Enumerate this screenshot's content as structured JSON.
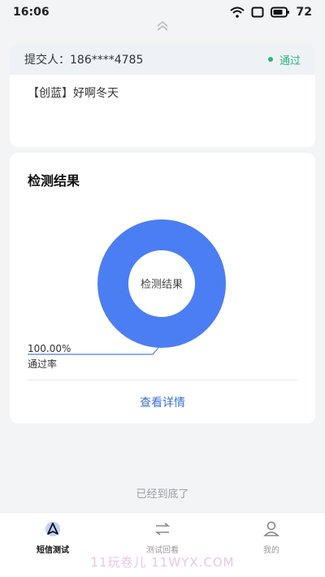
{
  "status_bar": {
    "time": "16:06",
    "battery": "72",
    "icons": [
      "wifi-icon",
      "window-icon",
      "battery-icon"
    ]
  },
  "submission": {
    "submitter_label": "提交人：",
    "submitter_value": "186****4785",
    "status": "通过",
    "status_color": "#2bb673",
    "message": "【创蓝】好啊冬天"
  },
  "result": {
    "title": "检测结果",
    "donut_center_label": "检测结果",
    "callout_value": "100.00%",
    "callout_label": "通过率",
    "detail_link": "查看详情"
  },
  "chart_data": {
    "type": "pie",
    "categories": [
      "通过率"
    ],
    "values": [
      100.0
    ],
    "colors": [
      "#4c7ef3"
    ]
  },
  "end_text": "已经到底了",
  "tabbar": {
    "items": [
      {
        "label": "短信测试",
        "icon": "send-icon",
        "active": true
      },
      {
        "label": "测试回看",
        "icon": "transfer-icon",
        "active": false
      },
      {
        "label": "我的",
        "icon": "user-icon",
        "active": false
      }
    ]
  },
  "watermark": "11玩卷儿 11WYX.COM",
  "colors": {
    "accent": "#4c7ef3",
    "link": "#3a6fd8",
    "success": "#2bb673"
  }
}
